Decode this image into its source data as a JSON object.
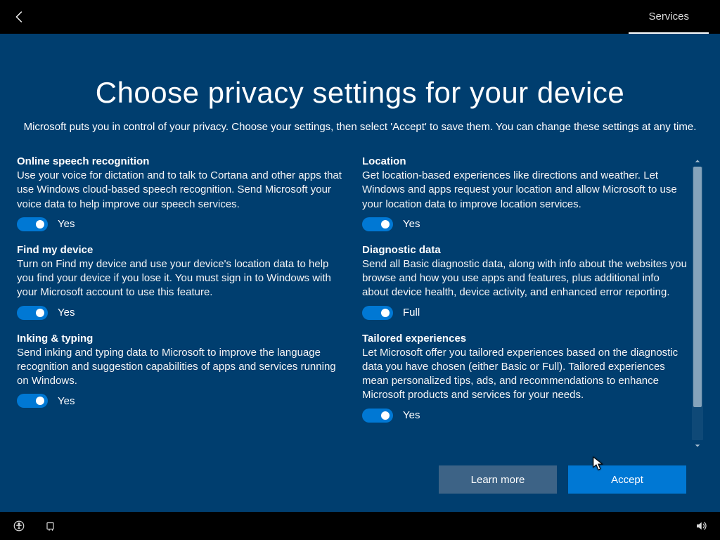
{
  "header": {
    "tab_label": "Services"
  },
  "title": "Choose privacy settings for your device",
  "subtitle": "Microsoft puts you in control of your privacy. Choose your settings, then select 'Accept' to save them. You can change these settings at any time.",
  "left": [
    {
      "title": "Online speech recognition",
      "desc": "Use your voice for dictation and to talk to Cortana and other apps that use Windows cloud-based speech recognition. Send Microsoft your voice data to help improve our speech services.",
      "state": "Yes"
    },
    {
      "title": "Find my device",
      "desc": "Turn on Find my device and use your device's location data to help you find your device if you lose it. You must sign in to Windows with your Microsoft account to use this feature.",
      "state": "Yes"
    },
    {
      "title": "Inking & typing",
      "desc": "Send inking and typing data to Microsoft to improve the language recognition and suggestion capabilities of apps and services running on Windows.",
      "state": "Yes"
    }
  ],
  "right": [
    {
      "title": "Location",
      "desc": "Get location-based experiences like directions and weather. Let Windows and apps request your location and allow Microsoft to use your location data to improve location services.",
      "state": "Yes"
    },
    {
      "title": "Diagnostic data",
      "desc": "Send all Basic diagnostic data, along with info about the websites you browse and how you use apps and features, plus additional info about device health, device activity, and enhanced error reporting.",
      "state": "Full"
    },
    {
      "title": "Tailored experiences",
      "desc": "Let Microsoft offer you tailored experiences based on the diagnostic data you have chosen (either Basic or Full). Tailored experiences mean personalized tips, ads, and recommendations to enhance Microsoft products and services for your needs.",
      "state": "Yes"
    }
  ],
  "buttons": {
    "learn_more": "Learn more",
    "accept": "Accept"
  }
}
